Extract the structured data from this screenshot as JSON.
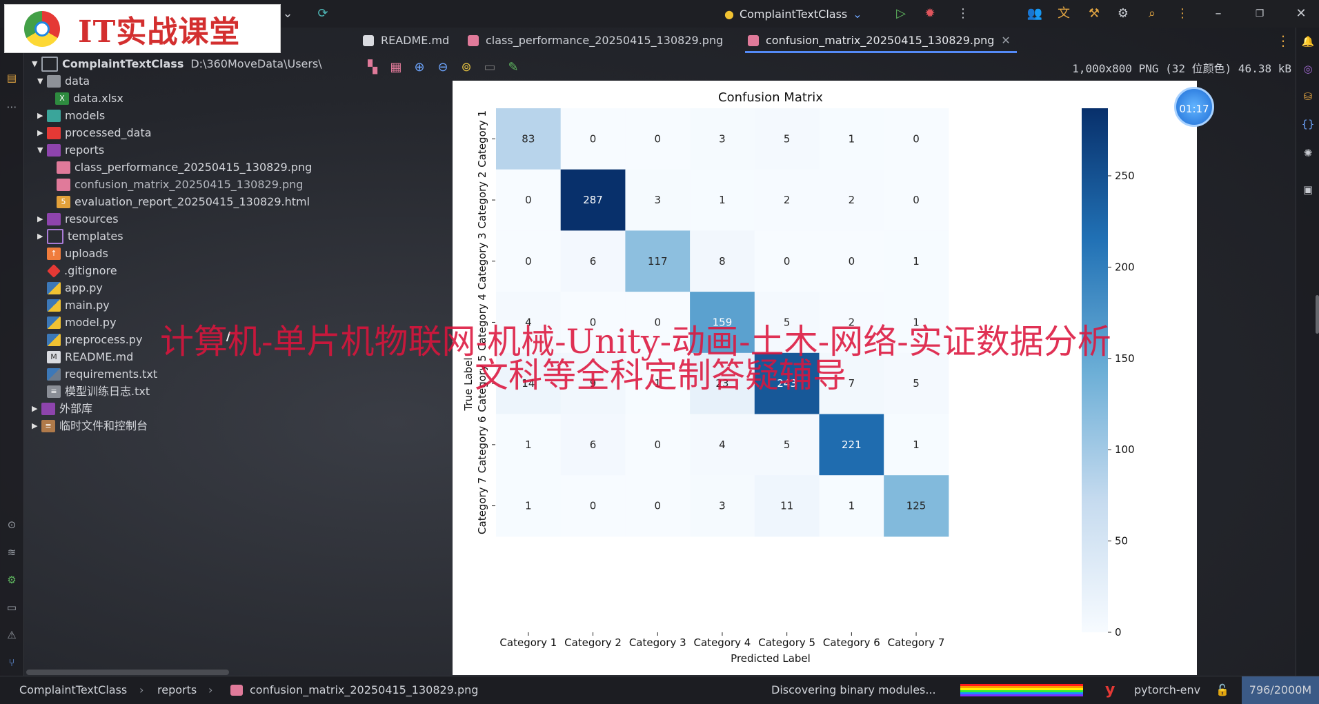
{
  "logo": {
    "text": "IT实战课堂"
  },
  "titlebar": {
    "project_name": "ComplaintTextClass",
    "icons": [
      "chevron-down-icon",
      "sync-icon",
      "python-icon",
      "run-icon",
      "debug-icon",
      "more-vert-icon",
      "account-icon",
      "translate-icon",
      "tools-icon",
      "ai-icon",
      "search-icon",
      "more-icon",
      "minimize-icon",
      "restore-icon",
      "close-icon"
    ]
  },
  "tree": {
    "root_name": "ComplaintTextClass",
    "root_path": "D:\\360MoveData\\Users\\",
    "items": [
      {
        "label": "data"
      },
      {
        "label": "data.xlsx"
      },
      {
        "label": "models"
      },
      {
        "label": "processed_data"
      },
      {
        "label": "reports"
      },
      {
        "label": "class_performance_20250415_130829.png"
      },
      {
        "label": "confusion_matrix_20250415_130829.png"
      },
      {
        "label": "evaluation_report_20250415_130829.html"
      },
      {
        "label": "resources"
      },
      {
        "label": "templates"
      },
      {
        "label": "uploads"
      },
      {
        "label": ".gitignore"
      },
      {
        "label": "app.py"
      },
      {
        "label": "main.py"
      },
      {
        "label": "model.py"
      },
      {
        "label": "preprocess.py"
      },
      {
        "label": "README.md"
      },
      {
        "label": "requirements.txt"
      },
      {
        "label": "模型训练日志.txt"
      },
      {
        "label": "外部库"
      },
      {
        "label": "临时文件和控制台"
      }
    ]
  },
  "tabs": [
    {
      "label": "README.md"
    },
    {
      "label": "class_performance_20250415_130829.png"
    },
    {
      "label": "confusion_matrix_20250415_130829.png",
      "close": "✕"
    }
  ],
  "image_info": "1,000x800 PNG (32 位颜色) 46.38 kB",
  "timer": "01:17",
  "watermark": {
    "line1": "计算机-单片机物联网-机械-Unity-动画-土木-网络-实证数据分析",
    "line2": "文科等全科定制答疑辅导"
  },
  "chart_data": {
    "type": "heatmap",
    "title": "Confusion Matrix",
    "xlabel": "Predicted Label",
    "ylabel": "True Label",
    "categories": [
      "Category 1",
      "Category 2",
      "Category 3",
      "Category 4",
      "Category 5",
      "Category 6",
      "Category 7"
    ],
    "matrix": [
      [
        83,
        0,
        0,
        3,
        5,
        1,
        0
      ],
      [
        0,
        287,
        3,
        1,
        2,
        2,
        0
      ],
      [
        0,
        6,
        117,
        8,
        0,
        0,
        1
      ],
      [
        4,
        0,
        0,
        159,
        5,
        2,
        1
      ],
      [
        14,
        9,
        1,
        23,
        243,
        7,
        5
      ],
      [
        1,
        6,
        0,
        4,
        5,
        221,
        1
      ],
      [
        1,
        0,
        0,
        3,
        11,
        1,
        125
      ]
    ],
    "colorscale": "Blues",
    "colorbar_ticks": [
      0,
      50,
      100,
      150,
      200,
      250
    ],
    "vmin": 0,
    "vmax": 287
  },
  "statusbar": {
    "crumbs": [
      "ComplaintTextClass",
      "reports",
      "confusion_matrix_20250415_130829.png"
    ],
    "task": "Discovering binary modules...",
    "env": "pytorch-env",
    "memory": "796/2000M"
  }
}
